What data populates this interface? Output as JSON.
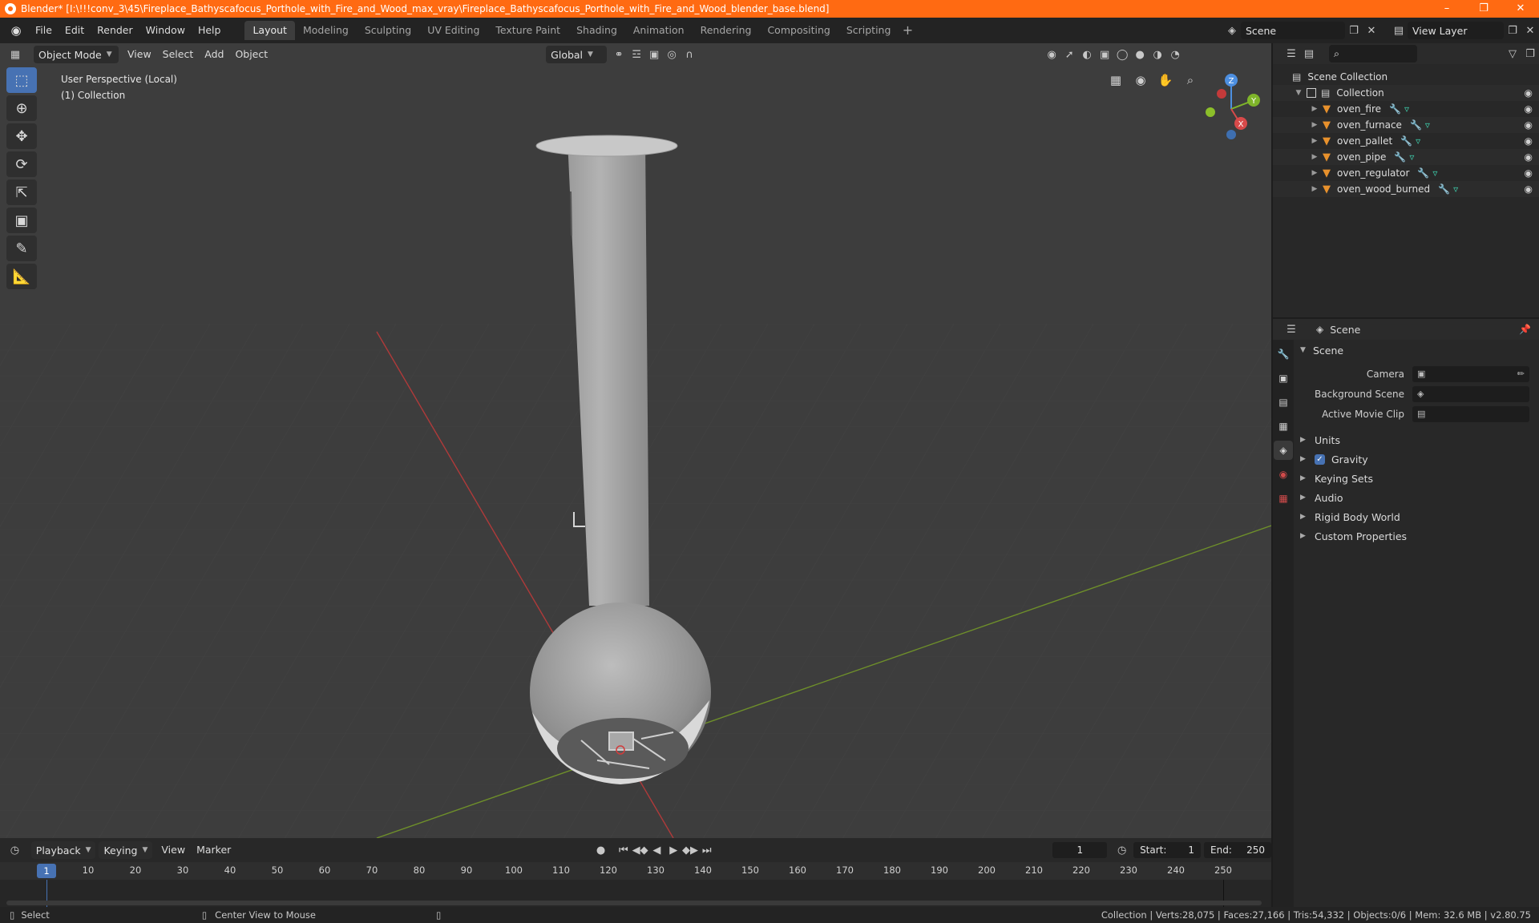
{
  "titlebar": {
    "title": "Blender* [I:\\!!!conv_3\\45\\Fireplace_Bathyscafocus_Porthole_with_Fire_and_Wood_max_vray\\Fireplace_Bathyscafocus_Porthole_with_Fire_and_Wood_blender_base.blend]",
    "minimize": "–",
    "maximize": "❐",
    "close": "✕"
  },
  "menubar": {
    "items": [
      "File",
      "Edit",
      "Render",
      "Window",
      "Help"
    ],
    "workspaces": [
      "Layout",
      "Modeling",
      "Sculpting",
      "UV Editing",
      "Texture Paint",
      "Shading",
      "Animation",
      "Rendering",
      "Compositing",
      "Scripting"
    ],
    "active_workspace": "Layout",
    "add_tab": "+",
    "scene": "Scene",
    "view_layer": "View Layer"
  },
  "viewport": {
    "mode": "Object Mode",
    "menus": [
      "View",
      "Select",
      "Add",
      "Object"
    ],
    "orientation": "Global",
    "info_line1": "User Perspective (Local)",
    "info_line2": "(1) Collection",
    "gizmo": {
      "z": "Z",
      "y": "Y",
      "x": "X"
    }
  },
  "outliner": {
    "root": "Scene Collection",
    "collection": "Collection",
    "items": [
      {
        "name": "oven_fire"
      },
      {
        "name": "oven_furnace"
      },
      {
        "name": "oven_pallet"
      },
      {
        "name": "oven_pipe"
      },
      {
        "name": "oven_regulator"
      },
      {
        "name": "oven_wood_burned"
      }
    ]
  },
  "properties": {
    "context": "Scene",
    "panel": "Scene",
    "fields": [
      {
        "label": "Camera"
      },
      {
        "label": "Background Scene"
      },
      {
        "label": "Active Movie Clip"
      }
    ],
    "subpanels": [
      "Units",
      "Gravity",
      "Keying Sets",
      "Audio",
      "Rigid Body World",
      "Custom Properties"
    ],
    "gravity_checked": true
  },
  "timeline": {
    "menus": [
      "Playback",
      "Keying",
      "View",
      "Marker"
    ],
    "current_frame": "1",
    "start_label": "Start:",
    "start_value": "1",
    "end_label": "End:",
    "end_value": "250",
    "ruler": [
      "10",
      "20",
      "30",
      "40",
      "50",
      "60",
      "70",
      "80",
      "90",
      "100",
      "110",
      "120",
      "130",
      "140",
      "150",
      "160",
      "170",
      "180",
      "190",
      "200",
      "210",
      "220",
      "230",
      "240",
      "250"
    ],
    "current_marker": "1"
  },
  "statusbar": {
    "left_action": "Select",
    "middle_action": "Center View to Mouse",
    "stats": "Collection | Verts:28,075 | Faces:27,166 | Tris:54,332 | Objects:0/6 | Mem: 32.6 MB | v2.80.75"
  }
}
